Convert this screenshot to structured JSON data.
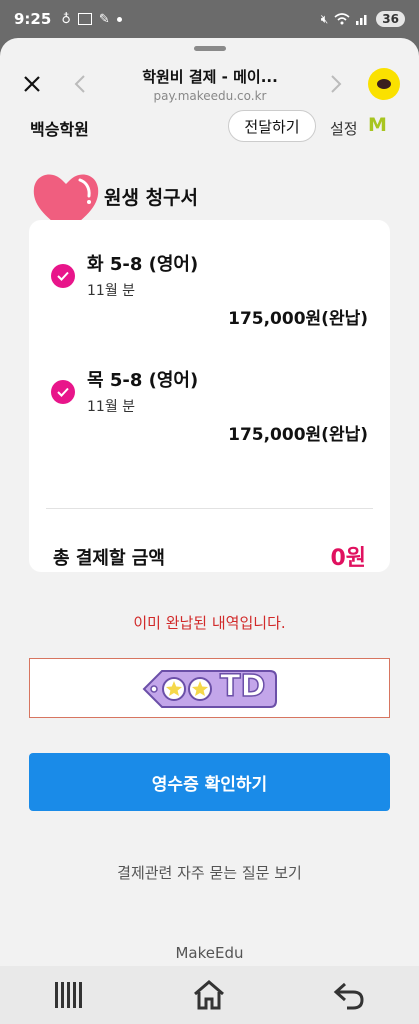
{
  "status_bar": {
    "time": "9:25",
    "battery": "36"
  },
  "browser": {
    "title": "학원비 결제 - 메이...",
    "url": "pay.makeedu.co.kr",
    "close_icon": "close-icon",
    "back_icon": "chevron-left-icon",
    "forward_icon": "chevron-right-icon",
    "kakaotalk_icon": "kakaotalk-icon"
  },
  "academy": {
    "name": "백승학원",
    "send_label": "전달하기",
    "settings_label": "설정",
    "logo_text": "M"
  },
  "invoice": {
    "title": "원생 청구서",
    "items": [
      {
        "name": "화 5-8 (영어)",
        "period": "11월 분",
        "price": "175,000원(완납)",
        "checked": true
      },
      {
        "name": "목 5-8 (영어)",
        "period": "11월 분",
        "price": "175,000원(완납)",
        "checked": true
      }
    ],
    "total_label": "총 결제할 금액",
    "total_value": "0원"
  },
  "notice": "이미 완납된 내역입니다.",
  "sticker_text": "TD",
  "receipt_button": "영수증 확인하기",
  "faq_link": "결제관련 자주 묻는 질문 보기",
  "footer": "MakeEdu",
  "colors": {
    "accent_pink": "#e8158a",
    "total_red": "#e0115f",
    "primary_blue": "#1a8be8",
    "notice_red": "#d12a2a"
  }
}
